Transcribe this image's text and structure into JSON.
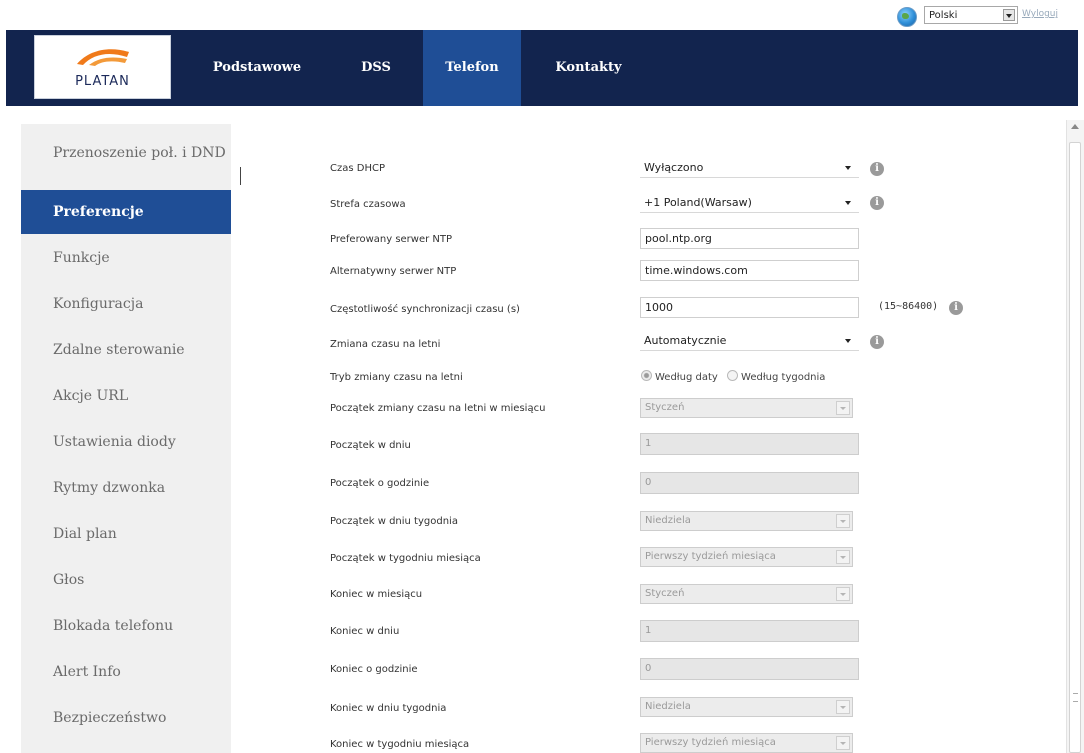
{
  "topbar": {
    "language": "Polski",
    "logout": "Wyloguj"
  },
  "logo": {
    "text": "PLATAN"
  },
  "nav": [
    {
      "label": "Podstawowe"
    },
    {
      "label": "DSS"
    },
    {
      "label": "Telefon"
    },
    {
      "label": "Kontakty"
    }
  ],
  "sidebar": [
    {
      "label": "Przenoszenie poł. i DND"
    },
    {
      "label": "Preferencje"
    },
    {
      "label": "Funkcje"
    },
    {
      "label": "Konfiguracja"
    },
    {
      "label": "Zdalne sterowanie"
    },
    {
      "label": "Akcje URL"
    },
    {
      "label": "Ustawienia diody"
    },
    {
      "label": "Rytmy dzwonka"
    },
    {
      "label": "Dial plan"
    },
    {
      "label": "Głos"
    },
    {
      "label": "Blokada telefonu"
    },
    {
      "label": "Alert Info"
    },
    {
      "label": "Bezpieczeństwo"
    }
  ],
  "form": {
    "dhcp_time": {
      "label": "Czas DHCP",
      "value": "Wyłączono"
    },
    "timezone": {
      "label": "Strefa czasowa",
      "value": "+1 Poland(Warsaw)"
    },
    "ntp_primary": {
      "label": "Preferowany serwer NTP",
      "value": "pool.ntp.org"
    },
    "ntp_alt": {
      "label": "Alternatywny serwer NTP",
      "value": "time.windows.com"
    },
    "sync_freq": {
      "label": "Częstotliwość synchronizacji czasu (s)",
      "value": "1000",
      "range": "(15~86400)"
    },
    "dst": {
      "label": "Zmiana czasu na letni",
      "value": "Automatycznie"
    },
    "dst_mode": {
      "label": "Tryb zmiany czasu na letni",
      "option_date": "Według daty",
      "option_week": "Według tygodnia"
    },
    "start_month": {
      "label": "Początek zmiany czasu na letni w miesiącu",
      "value": "Styczeń"
    },
    "start_day": {
      "label": "Początek w dniu",
      "value": "1"
    },
    "start_hour": {
      "label": "Początek o godzinie",
      "value": "0"
    },
    "start_weekday": {
      "label": "Początek w dniu tygodnia",
      "value": "Niedziela"
    },
    "start_week": {
      "label": "Początek w tygodniu miesiąca",
      "value": "Pierwszy tydzień miesiąca"
    },
    "end_month": {
      "label": "Koniec w miesiącu",
      "value": "Styczeń"
    },
    "end_day": {
      "label": "Koniec w dniu",
      "value": "1"
    },
    "end_hour": {
      "label": "Koniec o godzinie",
      "value": "0"
    },
    "end_weekday": {
      "label": "Koniec w dniu tygodnia",
      "value": "Niedziela"
    },
    "end_week": {
      "label": "Koniec w tygodniu miesiąca",
      "value": "Pierwszy tydzień miesiąca"
    }
  }
}
